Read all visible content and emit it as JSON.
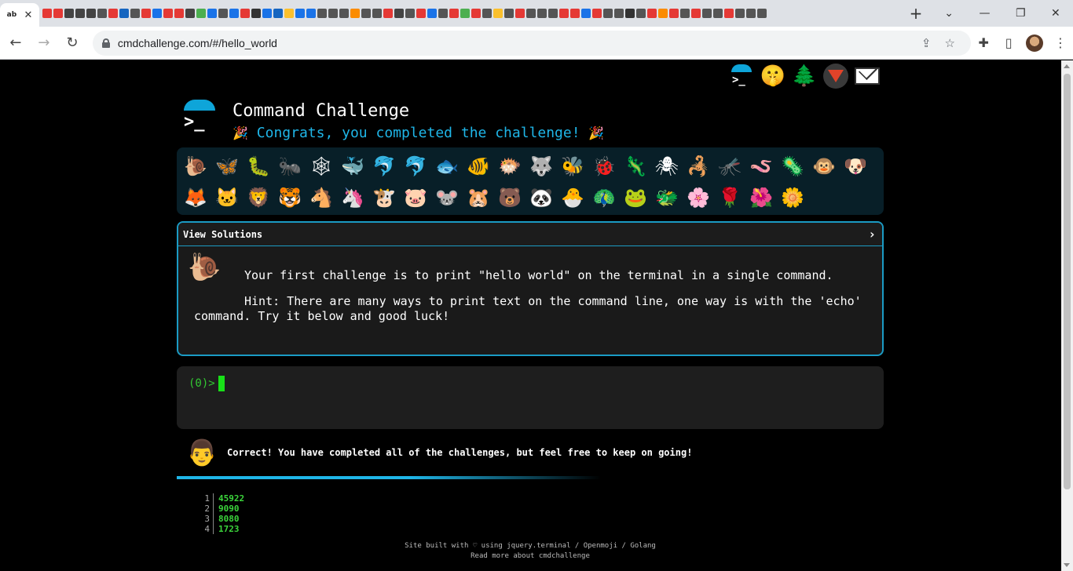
{
  "browser": {
    "url": "cmdchallenge.com/#/hello_world",
    "active_tab_favicon_text": "ab",
    "tab_close_glyph": "✕",
    "new_tab_glyph": "+",
    "window_controls": [
      "⌄",
      "—",
      "❐",
      "✕"
    ],
    "nav": {
      "back": "←",
      "forward": "→",
      "reload": "↻"
    },
    "favicon_colors": [
      "#e53935",
      "#e53935",
      "#444",
      "#444",
      "#444",
      "#555",
      "#e53935",
      "#1565c0",
      "#555",
      "#e53935",
      "#1a73e8",
      "#e53935",
      "#e53935",
      "#444",
      "#4caf50",
      "#1a73e8",
      "#555",
      "#1a73e8",
      "#e53935",
      "#333",
      "#1a73e8",
      "#1565c0",
      "#fbc02d",
      "#1a73e8",
      "#1a73e8",
      "#555",
      "#555",
      "#555",
      "#fb8c00",
      "#555",
      "#555",
      "#e53935",
      "#444",
      "#555",
      "#e53935",
      "#1a73e8",
      "#555",
      "#e53935",
      "#4caf50",
      "#e53935",
      "#555",
      "#fbc02d",
      "#555",
      "#e53935",
      "#555",
      "#555",
      "#555",
      "#e53935",
      "#e53935",
      "#1a73e8",
      "#e53935",
      "#555",
      "#555",
      "#333",
      "#555",
      "#e53935",
      "#fb8c00",
      "#e53935",
      "#555",
      "#e53935",
      "#555",
      "#555",
      "#e53935",
      "#555",
      "#555",
      "#555"
    ]
  },
  "site": {
    "title": "Command Challenge",
    "congrats": "Congrats, you completed the challenge!",
    "party_emoji": "🎉",
    "top_icons": [
      "terminal-logo",
      "shushing-face",
      "evergreen-tree",
      "gitlab",
      "envelope"
    ],
    "top_emoji": {
      "shush": "🤫",
      "tree": "🌲"
    },
    "animals_row1": [
      "🐌",
      "🦋",
      "🐛",
      "🐜",
      "🕸",
      "🐳",
      "🐬",
      "🐬",
      "🐟",
      "🐠",
      "🐡",
      "🐺",
      "🐝",
      "🐞",
      "🦎",
      "🕷",
      "🦂",
      "🦟",
      "🪱",
      "🦠",
      "🐵",
      "🐶"
    ],
    "animals_row2": [
      "🦊",
      "🐱",
      "🦁",
      "🐯",
      "🐴",
      "🦄",
      "🐮",
      "🐷",
      "🐭",
      "🐹",
      "🐻",
      "🐼",
      "🐣",
      "🦚",
      "🐸",
      "🐲",
      "🌸",
      "🌹",
      "🌺",
      "🌼"
    ],
    "solutions_label": "View Solutions",
    "solutions_chevron": "›",
    "challenge_emoji": "🐌",
    "challenge_text": "Your first challenge is to print \"hello world\" on the terminal in a single command.",
    "hint_text": "Hint: There are many ways to print text on the command line, one way is with the 'echo' command. Try it below and good luck!",
    "terminal_prompt": "(0)>",
    "correct_emoji": "👨",
    "correct_text": "Correct! You have completed all of the challenges, but feel free to keep on going!",
    "progress": 0.55,
    "list": [
      {
        "n": "1",
        "v": "45922"
      },
      {
        "n": "2",
        "v": "9090"
      },
      {
        "n": "3",
        "v": "8080"
      },
      {
        "n": "4",
        "v": "1723"
      }
    ],
    "footer_line1": "Site built with ♡ using jquery.terminal / Openmoji / Golang",
    "footer_line2": "Read more about cmdchallenge"
  }
}
